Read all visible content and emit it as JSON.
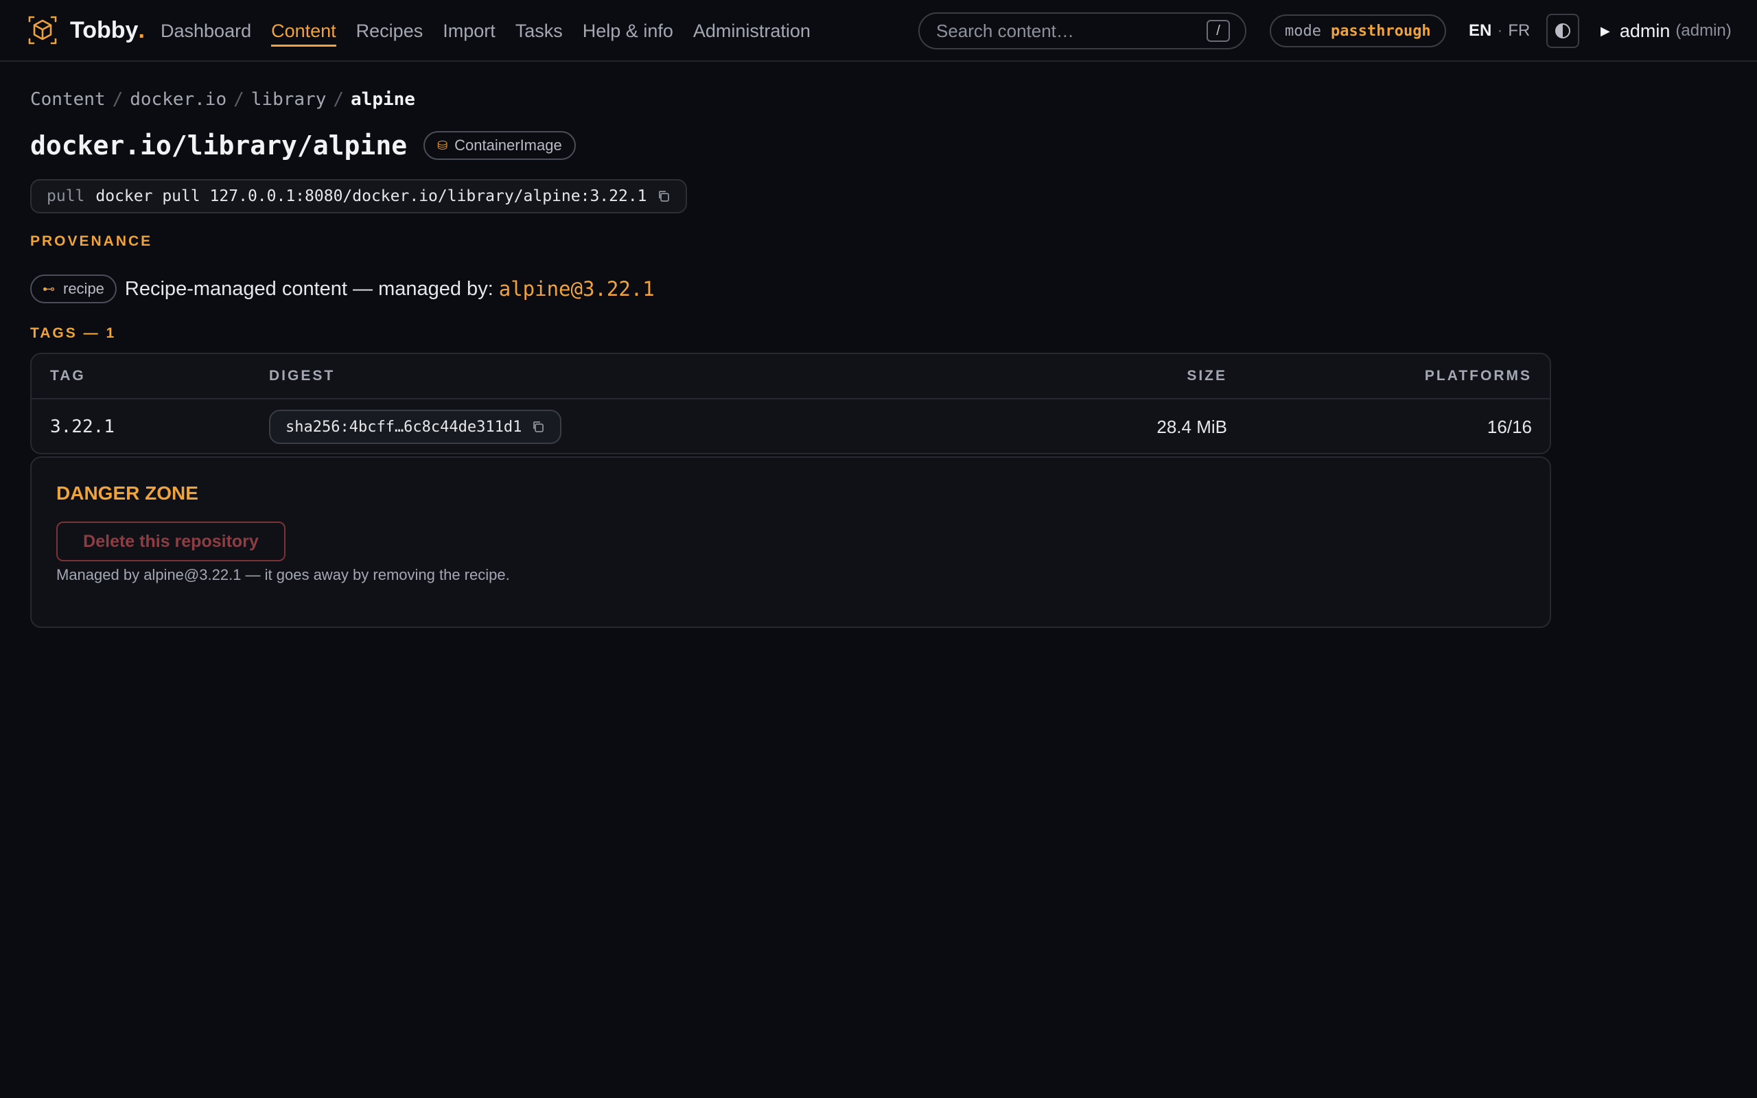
{
  "brand": {
    "name": "Tobby",
    "dot": "."
  },
  "nav": {
    "items": [
      {
        "label": "Dashboard"
      },
      {
        "label": "Content"
      },
      {
        "label": "Recipes"
      },
      {
        "label": "Import"
      },
      {
        "label": "Tasks"
      },
      {
        "label": "Help & info"
      },
      {
        "label": "Administration"
      }
    ],
    "active": "Content"
  },
  "search": {
    "placeholder": "Search content…",
    "shortcut": "/"
  },
  "mode": {
    "label": "mode",
    "value": "passthrough"
  },
  "lang": {
    "current": "EN",
    "separator": "·",
    "other": "FR"
  },
  "theme": {
    "icon": "contrast-icon"
  },
  "user": {
    "name": "admin",
    "role": "(admin)"
  },
  "breadcrumb": {
    "items": [
      "Content",
      "docker.io",
      "library"
    ],
    "current": "alpine",
    "separator": "/"
  },
  "page": {
    "title": "docker.io/library/alpine",
    "type_badge": "ContainerImage"
  },
  "pull": {
    "label": "pull",
    "command": "docker pull 127.0.0.1:8080/docker.io/library/alpine:3.22.1"
  },
  "provenance": {
    "heading": "PROVENANCE",
    "badge": "recipe",
    "text": "Recipe-managed content — managed by:",
    "link": "alpine@3.22.1"
  },
  "tags": {
    "heading": "TAGS — 1",
    "columns": [
      "TAG",
      "DIGEST",
      "SIZE",
      "PLATFORMS"
    ],
    "rows": [
      {
        "tag": "3.22.1",
        "digest": "sha256:4bcff…6c8c44de311d1",
        "size": "28.4 MiB",
        "platforms": "16/16"
      }
    ]
  },
  "danger": {
    "title": "DANGER ZONE",
    "button": "Delete this repository",
    "note": "Managed by alpine@3.22.1 — it goes away by removing the recipe."
  },
  "colors": {
    "accent": "#f0a33a",
    "background": "#0b0c12",
    "danger": "#7a3337"
  }
}
